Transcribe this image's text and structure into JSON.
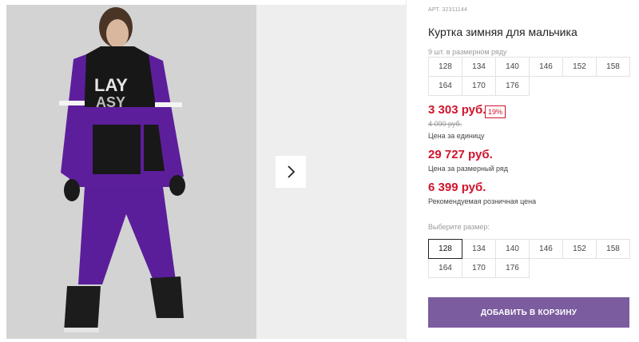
{
  "product": {
    "article": "АРТ. 32311144",
    "title": "Куртка зимняя для мальчика",
    "size_row_label": "9 шт. в размерном ряду",
    "row_sizes": [
      "128",
      "134",
      "140",
      "146",
      "152",
      "158",
      "164",
      "170",
      "176"
    ]
  },
  "pricing": {
    "price": "3 303 руб.",
    "discount": "19%",
    "old_price": "4 090 руб.",
    "unit_caption": "Цена за единицу",
    "row_price": "29 727 руб.",
    "row_caption": "Цена за размерный ряд",
    "retail_price": "6 399 руб.",
    "retail_caption": "Рекомендуемая розничная цена"
  },
  "size_picker": {
    "label": "Выберите размер:",
    "sizes": [
      "128",
      "134",
      "140",
      "146",
      "152",
      "158",
      "164",
      "170",
      "176"
    ],
    "selected": "128"
  },
  "cart": {
    "button_label": "ДОБАВИТЬ В КОРЗИНУ"
  },
  "colors": {
    "accent": "#7b5c9e",
    "price_red": "#d0142c",
    "jacket_purple": "#5d1e9c"
  },
  "icons": {
    "next": "chevron-right-icon"
  }
}
